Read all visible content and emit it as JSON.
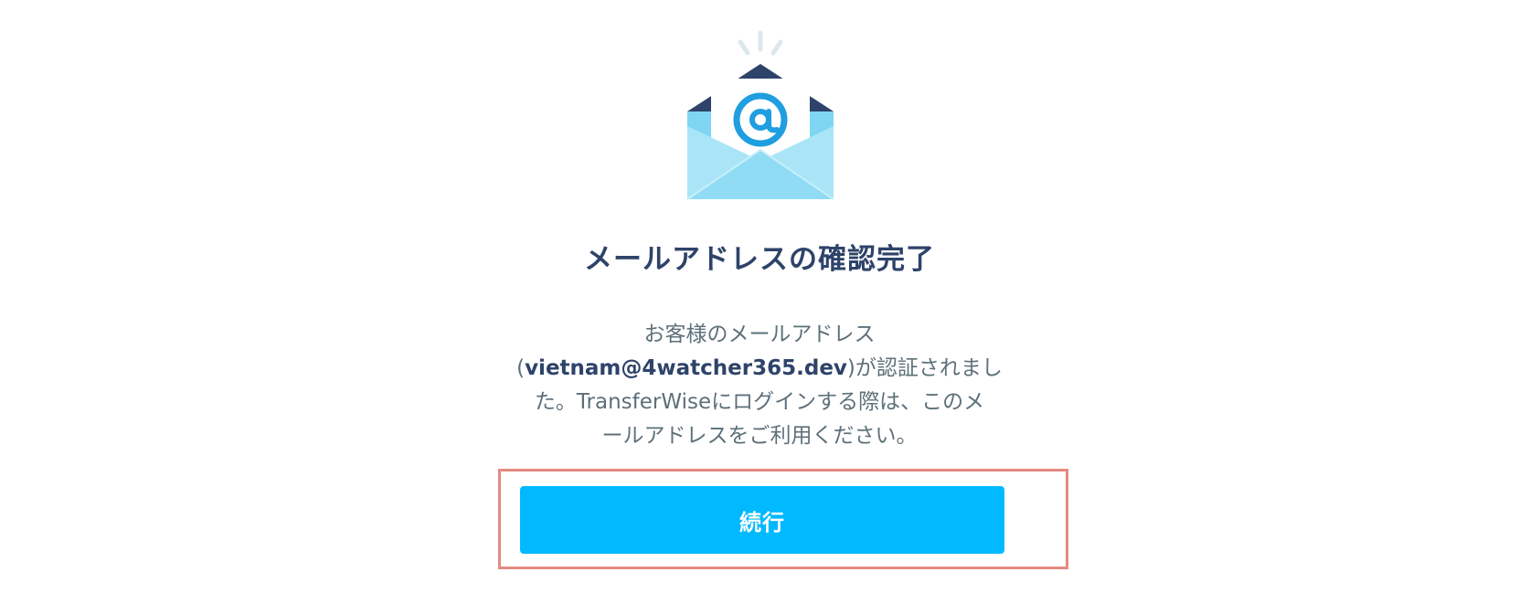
{
  "illustration": {
    "icon": "envelope-at-icon",
    "colors": {
      "envelope_light": "#a9e5f7",
      "envelope_mid": "#7fd6f2",
      "flap_dark": "#2e4369",
      "letter": "#ffffff",
      "at_symbol": "#1f9ee0",
      "sparkle": "#dce8ec"
    }
  },
  "title": "メールアドレスの確認完了",
  "message": {
    "line1": "お客様のメールアドレス",
    "line2_open": "(",
    "email": "vietnam@4watcher365.dev",
    "line2_close": ")が認証されまし",
    "line3": "た。TransferWiseにログインする際は、このメ",
    "line4": "ールアドレスをご利用ください。"
  },
  "button": {
    "label": "続行",
    "color": "#00b9ff",
    "highlight_color": "#e58a82"
  }
}
